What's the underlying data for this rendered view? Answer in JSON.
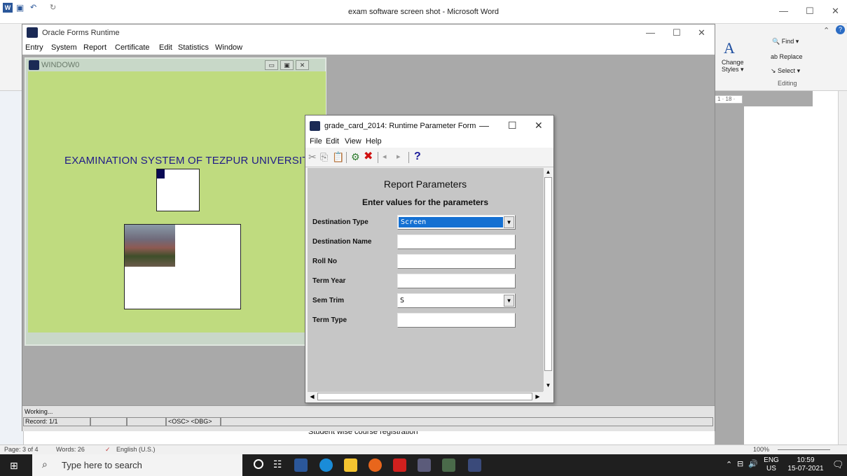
{
  "word": {
    "window_title": "exam software screen shot - Microsoft Word",
    "ribbon": {
      "find": "Find",
      "replace": "Replace",
      "select": "Select",
      "change_styles_1": "Change",
      "change_styles_2": "Styles",
      "editing": "Editing"
    },
    "ruler_text": "1 · 18 ·",
    "status": {
      "page": "Page: 3 of 4",
      "words": "Words: 26",
      "language": "English (U.S.)",
      "zoom": "100%"
    },
    "doc_text": "Student wise course registration"
  },
  "oracle": {
    "title": "Oracle Forms Runtime",
    "menu": [
      "Entry",
      "System",
      "Report",
      "Certificate",
      "Edit",
      "Statistics",
      "Window"
    ],
    "window0_title": "WINDOW0",
    "exam_title": "EXAMINATION SYSTEM OF TEZPUR UNIVERSIT",
    "status_working": "Working...",
    "status_record": "Record: 1/1",
    "status_osc": "<OSC> <DBG>"
  },
  "rpf": {
    "title": "grade_card_2014: Runtime Parameter Form",
    "menu": [
      "File",
      "Edit",
      "View",
      "Help"
    ],
    "heading": "Report Parameters",
    "subheading": "Enter values for the parameters",
    "params": [
      {
        "label": "Destination Type",
        "value": "Screen"
      },
      {
        "label": "Destination Name",
        "value": ""
      },
      {
        "label": "Roll No",
        "value": ""
      },
      {
        "label": "Term Year",
        "value": ""
      },
      {
        "label": "Sem Trim",
        "value": "S"
      },
      {
        "label": "Term Type",
        "value": ""
      }
    ]
  },
  "taskbar": {
    "search_placeholder": "Type here to search",
    "lang_1": "ENG",
    "lang_2": "US",
    "time": "10:59",
    "date": "15-07-2021"
  },
  "colors": {
    "form_bg": "#bfdb7f",
    "exam_title": "#1f1a88",
    "selection": "#1470d2"
  }
}
